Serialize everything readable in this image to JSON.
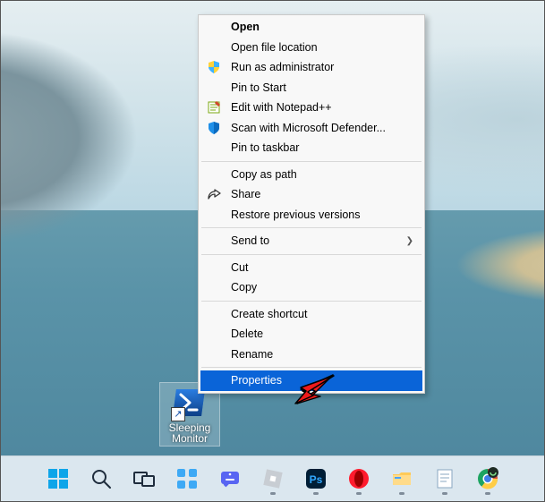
{
  "shortcut": {
    "label": "Sleeping Monitor"
  },
  "context_menu": {
    "items": [
      {
        "label": "Open",
        "bold": true
      },
      {
        "label": "Open file location"
      },
      {
        "label": "Run as administrator",
        "icon": "uac-shield-icon"
      },
      {
        "label": "Pin to Start"
      },
      {
        "label": "Edit with Notepad++",
        "icon": "notepadpp-icon"
      },
      {
        "label": "Scan with Microsoft Defender...",
        "icon": "defender-shield-icon"
      },
      {
        "label": "Pin to taskbar"
      },
      {
        "type": "sep"
      },
      {
        "label": "Copy as path"
      },
      {
        "label": "Share",
        "icon": "share-icon"
      },
      {
        "label": "Restore previous versions"
      },
      {
        "type": "sep"
      },
      {
        "label": "Send to",
        "submenu": true
      },
      {
        "type": "sep"
      },
      {
        "label": "Cut"
      },
      {
        "label": "Copy"
      },
      {
        "type": "sep"
      },
      {
        "label": "Create shortcut"
      },
      {
        "label": "Delete"
      },
      {
        "label": "Rename"
      },
      {
        "type": "sep"
      },
      {
        "label": "Properties",
        "selected": true
      }
    ]
  },
  "taskbar": {
    "items": [
      {
        "name": "start-button"
      },
      {
        "name": "search-button"
      },
      {
        "name": "task-view-button"
      },
      {
        "name": "widgets-button"
      },
      {
        "name": "chat-button"
      },
      {
        "name": "roblox-app",
        "running": true
      },
      {
        "name": "photoshop-app",
        "running": true
      },
      {
        "name": "opera-app",
        "running": true
      },
      {
        "name": "explorer-app",
        "running": true
      },
      {
        "name": "notepad-app",
        "running": true
      },
      {
        "name": "chrome-app",
        "running": true
      }
    ]
  }
}
